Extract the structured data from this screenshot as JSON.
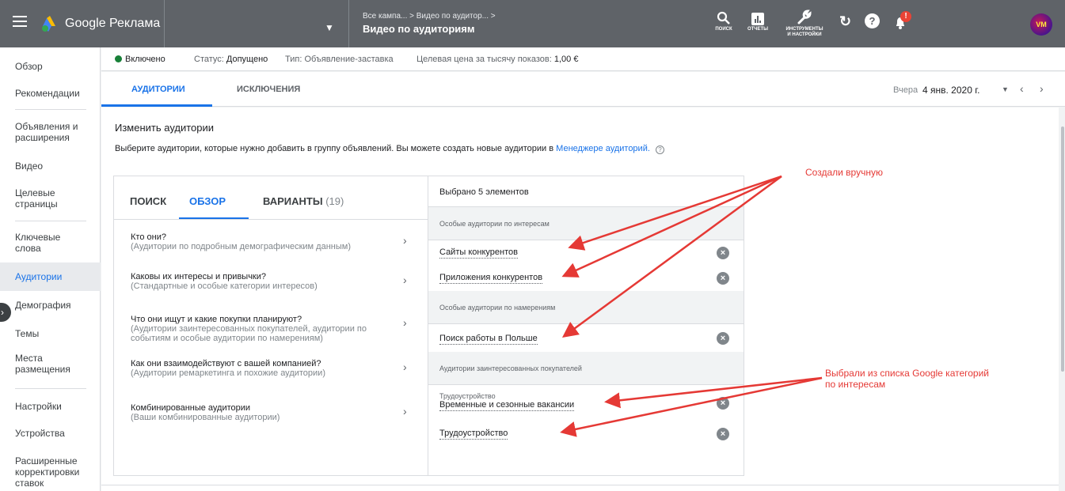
{
  "app": {
    "title": "Google Реклама"
  },
  "topbar": {
    "breadcrumb_campaigns": "Все кампа...",
    "breadcrumb_sep": ">",
    "breadcrumb_group": "Видео по аудитор...",
    "breadcrumb_tail": ">",
    "page_title": "Видео по аудиториям",
    "campaign_dropdown": "▼",
    "tools": [
      {
        "label": "ПОИСК",
        "icon": "search-icon"
      },
      {
        "label": "ОТЧЕТЫ",
        "icon": "reports-icon"
      },
      {
        "label": "ИНСТРУМЕНТЫ И НАСТРОЙКИ",
        "label_line1": "ИНСТРУМЕНТЫ",
        "label_line2": "И НАСТРОЙКИ",
        "icon": "wrench-icon"
      }
    ],
    "refresh_icon": "↻",
    "help_icon": "?",
    "notification_badge": "!",
    "avatar_text": "VM"
  },
  "sidebar": {
    "items": [
      {
        "label": "Обзор"
      },
      {
        "label": "Рекомендации"
      },
      {
        "label": "Объявления и расширения",
        "line1": "Объявления и",
        "line2": "расширения"
      },
      {
        "label": "Видео"
      },
      {
        "label": "Целевые страницы",
        "line1": "Целевые",
        "line2": "страницы"
      },
      {
        "label": "Ключевые слова",
        "line1": "Ключевые",
        "line2": "слова"
      },
      {
        "label": "Аудитории",
        "active": true
      },
      {
        "label": "Демография"
      },
      {
        "label": "Темы"
      },
      {
        "label": "Места размещения",
        "line1": "Места",
        "line2": "размещения"
      },
      {
        "label": "Настройки"
      },
      {
        "label": "Устройства"
      },
      {
        "label": "Расширенные корректировки ставок",
        "line1": "Расширенные",
        "line2": "корректировки",
        "line3": "ставок"
      }
    ],
    "collapse_icon": "›"
  },
  "status": {
    "enabled_label": "Включено",
    "status_label": "Статус:",
    "status_value": "Допущено",
    "type_label": "Тип:",
    "type_value": "Объявление-заставка",
    "cpm_label": "Целевая цена за тысячу показов:",
    "cpm_value": "1,00 €",
    "enabled_color": "#188038"
  },
  "tabs": {
    "audiences": "АУДИТОРИИ",
    "exclusions": "ИСКЛЮЧЕНИЯ",
    "date_label": "Вчера",
    "date_value": "4 янв. 2020 г.",
    "date_dropdown": "▼",
    "prev": "‹",
    "next": "›"
  },
  "editor": {
    "title": "Изменить аудитории",
    "desc_before": "Выберите аудитории, которые нужно добавить в группу объявлений. Вы можете создать новые аудитории в",
    "desc_link": "Менеджере аудиторий.",
    "help": "?",
    "left_tabs": {
      "search": "ПОИСК",
      "browse": "ОБЗОР",
      "ideas": "ВАРИАНТЫ",
      "ideas_count": "(19)"
    },
    "categories": [
      {
        "title": "Кто они?",
        "sub1": "(Аудитории по подробным демографическим данным)"
      },
      {
        "title": "Каковы их интересы и привычки?",
        "sub1": "(Стандартные и особые категории интересов)"
      },
      {
        "title": "Что они ищут и какие покупки планируют?",
        "sub1": "(Аудитории заинтересованных покупателей, аудитории по",
        "sub2": "событиям и особые аудитории по намерениям)"
      },
      {
        "title": "Как они взаимодействуют с вашей компанией?",
        "sub1": "(Аудитории ремаркетинга и похожие аудитории)"
      },
      {
        "title": "Комбинированные аудитории",
        "sub1": "(Ваши комбинированные аудитории)"
      }
    ],
    "arrow": "›",
    "selected_header": "Выбрано 5 элементов",
    "groups": [
      {
        "label": "Особые аудитории по интересам"
      },
      {
        "label": "Особые аудитории по намерениям"
      },
      {
        "label": "Аудитории заинтересованных покупателей"
      }
    ],
    "selected": [
      {
        "label": "Сайты конкурентов"
      },
      {
        "label": "Приложения конкурентов"
      },
      {
        "label": "Поиск работы в Польше"
      },
      {
        "parent": "Трудоустройство",
        "label": "Временные и сезонные вакансии"
      },
      {
        "label": "Трудоустройство"
      }
    ],
    "remove_icon": "×"
  },
  "annotations": {
    "manual": "Создали вручную",
    "from_list_line1": "Выбрали из списка Google категорий",
    "from_list_line2": "по интересам",
    "color": "#e53935"
  }
}
